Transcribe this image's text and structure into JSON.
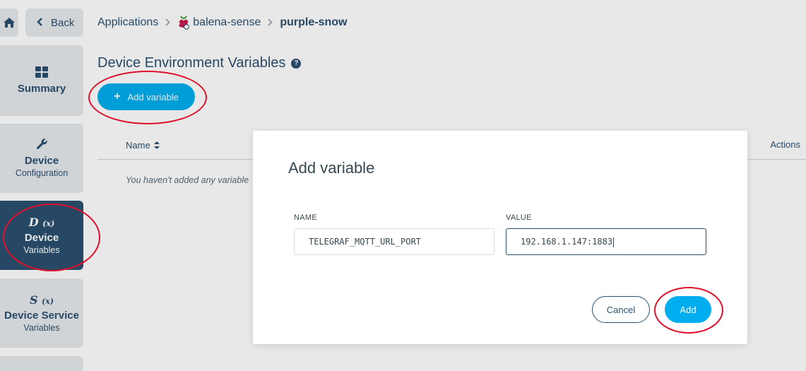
{
  "nav": {
    "back_label": "Back",
    "breadcrumb": [
      {
        "label": "Applications"
      },
      {
        "label": "balena-sense",
        "icon": "raspberry-pi-icon"
      },
      {
        "label": "purple-snow"
      }
    ]
  },
  "sidebar": {
    "items": [
      {
        "icon": "grid-icon",
        "label": "Summary",
        "sub": ""
      },
      {
        "icon": "wrench-icon",
        "label": "Device",
        "sub": "Configuration"
      },
      {
        "symbol": "D",
        "symbol_sub": "(x)",
        "label": "Device",
        "sub": "Variables",
        "active": true
      },
      {
        "symbol": "S",
        "symbol_sub": "(x)",
        "label": "Device Service",
        "sub": "Variables"
      }
    ]
  },
  "page": {
    "title": "Device Environment Variables",
    "add_button": "Add variable",
    "table": {
      "col_name": "Name",
      "col_actions": "Actions",
      "empty_message": "You haven't added any variable"
    }
  },
  "modal": {
    "title": "Add variable",
    "name_label": "NAME",
    "name_value": "TELEGRAF_MQTT_URL_PORT",
    "value_label": "VALUE",
    "value_value": "192.168.1.147:1883",
    "cancel_label": "Cancel",
    "add_label": "Add"
  },
  "colors": {
    "primary": "#00aeef",
    "navy": "#2a506f",
    "annotation": "#e0102b"
  }
}
